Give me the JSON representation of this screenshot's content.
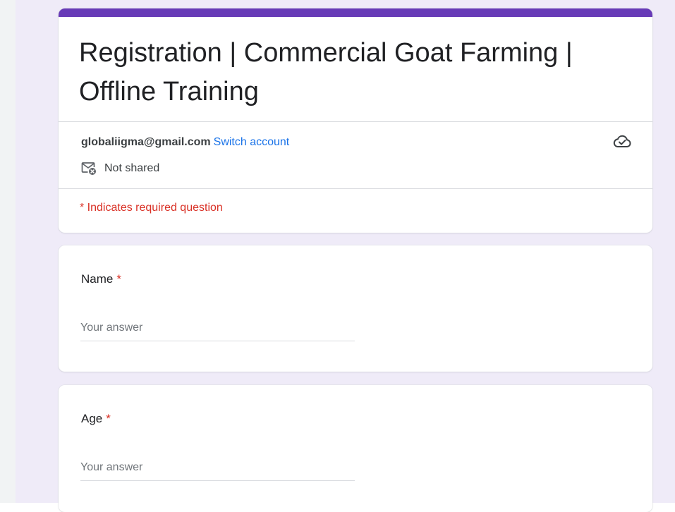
{
  "form": {
    "title": "Registration | Commercial Goat Farming | Offline Training",
    "accent_color": "#673ab7",
    "account": {
      "email": "globaliigma@gmail.com",
      "switch_label": "Switch account",
      "cloud_icon": "cloud-check-icon"
    },
    "sharing": {
      "icon": "mail-not-shared-icon",
      "label": "Not shared"
    },
    "required_note": "* Indicates required question"
  },
  "questions": [
    {
      "label": "Name",
      "required_mark": "*",
      "placeholder": "Your answer",
      "value": ""
    },
    {
      "label": "Age",
      "required_mark": "*",
      "placeholder": "Your answer",
      "value": ""
    }
  ],
  "colors": {
    "link": "#1a73e8",
    "required": "#d93025",
    "page_background": "#efebf8"
  }
}
